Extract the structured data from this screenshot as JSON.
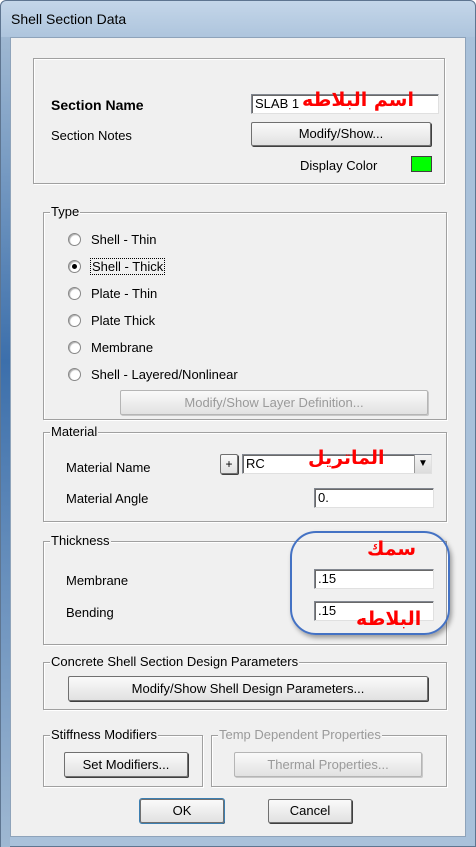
{
  "window": {
    "title": "Shell Section Data"
  },
  "section": {
    "name_label": "Section Name",
    "name_value": "SLAB 1",
    "name_annotation": "اسم البلاطه",
    "notes_label": "Section Notes",
    "notes_button": "Modify/Show...",
    "display_color_label": "Display Color",
    "display_color": "#00ff00"
  },
  "type": {
    "group_label": "Type",
    "options": [
      "Shell - Thin",
      "Shell - Thick",
      "Plate - Thin",
      "Plate Thick",
      "Membrane",
      "Shell - Layered/Nonlinear"
    ],
    "selected": "Shell - Thick",
    "layer_button": "Modify/Show Layer Definition..."
  },
  "material": {
    "group_label": "Material",
    "name_label": "Material Name",
    "plus_button": "+",
    "name_value": "RC",
    "name_annotation": "الماتريل",
    "angle_label": "Material Angle",
    "angle_value": "0."
  },
  "thickness": {
    "group_label": "Thickness",
    "membrane_label": "Membrane",
    "membrane_value": ".15",
    "bending_label": "Bending",
    "bending_value": ".15",
    "annotation_top": "سمك",
    "annotation_bottom": "البلاطه"
  },
  "design": {
    "group_label": "Concrete Shell Section Design Parameters",
    "button": "Modify/Show Shell Design Parameters..."
  },
  "stiffness": {
    "group_label": "Stiffness Modifiers",
    "button": "Set Modifiers..."
  },
  "temp": {
    "group_label": "Temp Dependent Properties",
    "button": "Thermal Properties..."
  },
  "actions": {
    "ok": "OK",
    "cancel": "Cancel"
  },
  "colors": {
    "annotation": "#ff0000",
    "highlight_oval": "#4472c4"
  }
}
